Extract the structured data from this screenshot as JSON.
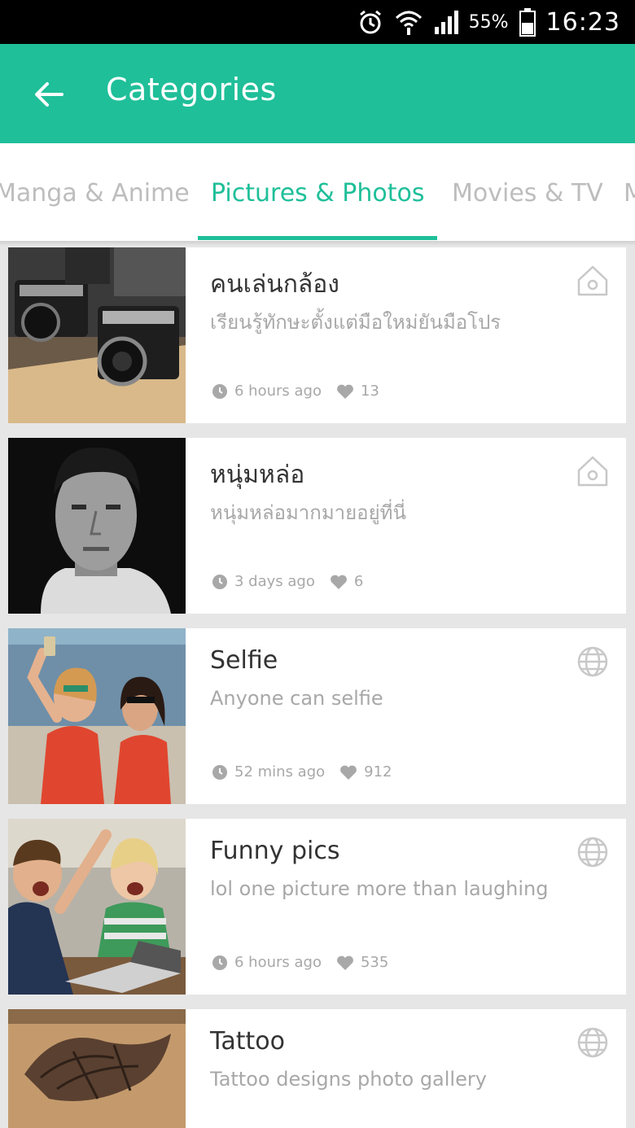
{
  "status_bar": {
    "battery": "55%",
    "time": "16:23",
    "icons": [
      "alarm-icon",
      "wifi-icon",
      "signal-icon",
      "battery-icon"
    ]
  },
  "app_bar": {
    "title": "Categories",
    "back_icon": "arrow-left-icon",
    "color": "#1fbf99"
  },
  "tabs": [
    {
      "label": "Manga & Anime",
      "active": false
    },
    {
      "label": "Pictures & Photos",
      "active": true
    },
    {
      "label": "Movies & TV",
      "active": false
    },
    {
      "label": "M",
      "active": false
    }
  ],
  "cards": [
    {
      "title": "คนเล่นกล้อง",
      "description": "เรียนรู้ทักษะตั้งแต่มือใหม่ยันมือโปร",
      "time": "6 hours ago",
      "likes": "13",
      "type_icon": "home-icon",
      "thumb": "vintage-cameras"
    },
    {
      "title": "หนุ่มหล่อ",
      "description": "หนุ่มหล่อมากมายอยู่ที่นี่",
      "time": "3 days ago",
      "likes": "6",
      "type_icon": "home-icon",
      "thumb": "man-portrait"
    },
    {
      "title": "Selfie",
      "description": "Anyone can selfie",
      "time": "52 mins ago",
      "likes": "912",
      "type_icon": "globe-icon",
      "thumb": "selfie-women"
    },
    {
      "title": "Funny pics",
      "description": "lol one picture more than laughing",
      "time": "6 hours ago",
      "likes": "535",
      "type_icon": "globe-icon",
      "thumb": "kids-laughing"
    },
    {
      "title": "Tattoo",
      "description": "Tattoo designs photo gallery",
      "time": "",
      "likes": "",
      "type_icon": "globe-icon",
      "thumb": "tattoo"
    }
  ]
}
